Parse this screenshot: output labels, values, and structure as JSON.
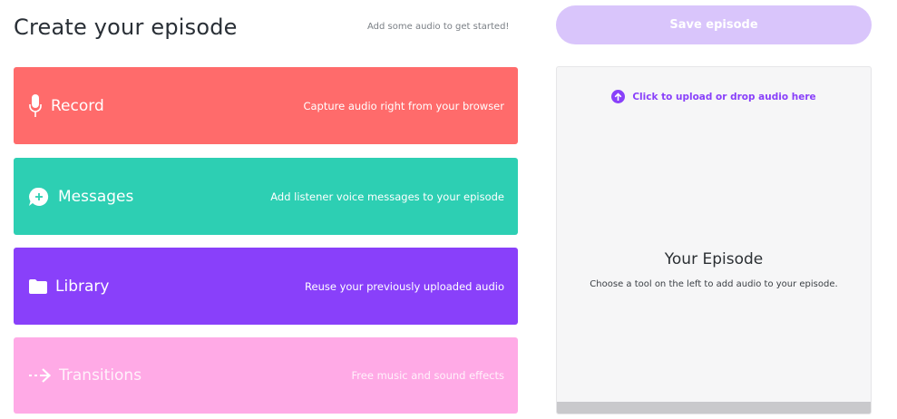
{
  "header": {
    "title": "Create your episode",
    "hint": "Add some audio to get started!"
  },
  "tools": [
    {
      "name": "Record",
      "description": "Capture audio right from your browser",
      "icon": "microphone-icon",
      "color": "#ff6b6b"
    },
    {
      "name": "Messages",
      "description": "Add listener voice messages to your episode",
      "icon": "message-plus-icon",
      "color": "#2dcfb3"
    },
    {
      "name": "Library",
      "description": "Reuse your previously uploaded audio",
      "icon": "folder-icon",
      "color": "#8940fa"
    },
    {
      "name": "Transitions",
      "description": "Free music and sound effects",
      "icon": "arrow-right-icon",
      "color": "#ffaae6"
    }
  ],
  "save_button": {
    "label": "Save episode",
    "color": "#d9c5fb"
  },
  "episode": {
    "upload_text": "Click to upload or drop audio here",
    "upload_icon": "upload-arrow-icon",
    "accent": "#8940fa",
    "title": "Your Episode",
    "subtitle": "Choose a tool on the left to add audio to your episode."
  }
}
